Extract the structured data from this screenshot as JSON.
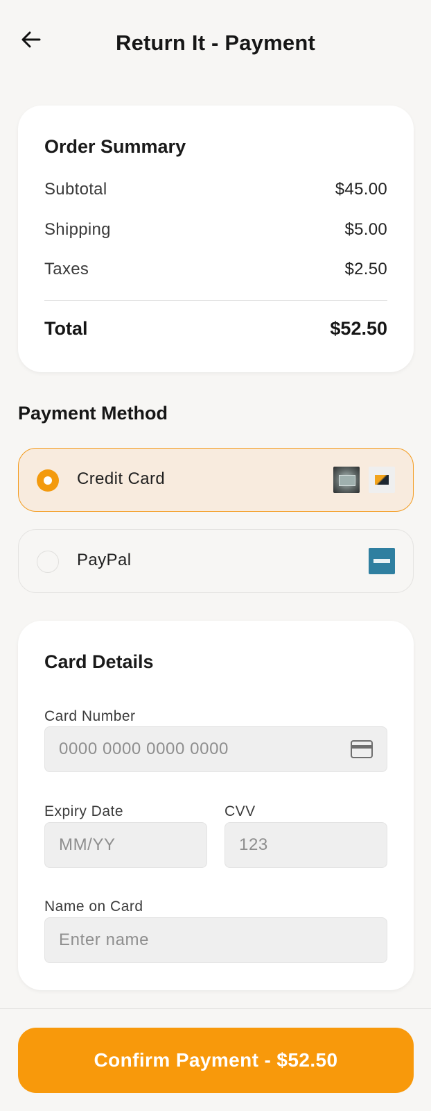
{
  "header": {
    "title": "Return It - Payment",
    "back_icon": "arrow-left-icon"
  },
  "order_summary": {
    "title": "Order Summary",
    "rows": [
      {
        "label": "Subtotal",
        "value": "$45.00"
      },
      {
        "label": "Shipping",
        "value": "$5.00"
      },
      {
        "label": "Taxes",
        "value": "$2.50"
      }
    ],
    "total_label": "Total",
    "total_value": "$52.50"
  },
  "payment_method": {
    "title": "Payment Method",
    "options": [
      {
        "label": "Credit Card",
        "selected": true
      },
      {
        "label": "PayPal",
        "selected": false
      }
    ]
  },
  "card_details": {
    "title": "Card Details",
    "card_number": {
      "label": "Card Number",
      "placeholder": "0000 0000 0000 0000",
      "value": "",
      "icon": "credit-card-icon"
    },
    "expiry": {
      "label": "Expiry Date",
      "placeholder": "MM/YY",
      "value": ""
    },
    "cvv": {
      "label": "CVV",
      "placeholder": "123",
      "value": ""
    },
    "name": {
      "label": "Name on Card",
      "placeholder": "Enter name",
      "value": ""
    }
  },
  "footer": {
    "confirm_label": "Confirm Payment - $52.50"
  },
  "colors": {
    "accent": "#f8990b",
    "selected_bg": "#f8ebde",
    "page_bg": "#f7f6f4"
  }
}
